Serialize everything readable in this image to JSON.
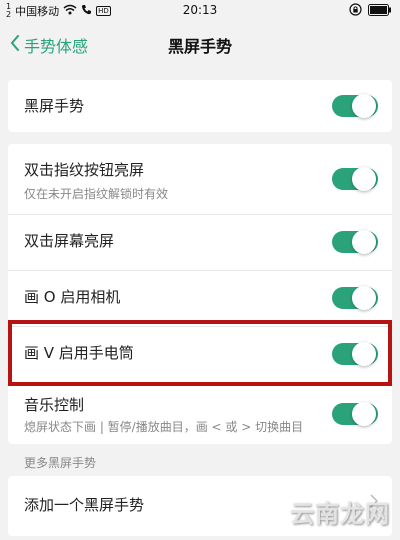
{
  "status_bar": {
    "signal_top": "1",
    "signal_bottom": "2",
    "carrier": "中国移动",
    "hd_badge": "HD",
    "time": "20:13",
    "icons": [
      "wifi-icon",
      "phone-icon",
      "rotation-lock-icon",
      "battery-icon"
    ]
  },
  "nav": {
    "back_label": "手势体感",
    "title": "黑屏手势"
  },
  "rows": [
    {
      "title": "黑屏手势",
      "subtitle": "",
      "toggle_on": true
    },
    {
      "title": "双击指纹按钮亮屏",
      "subtitle": "仅在未开启指纹解锁时有效",
      "toggle_on": true
    },
    {
      "title": "双击屏幕亮屏",
      "subtitle": "",
      "toggle_on": true
    },
    {
      "title": "画 O 启用相机",
      "subtitle": "",
      "toggle_on": true
    },
    {
      "title": "画 V 启用手电筒",
      "subtitle": "",
      "toggle_on": true
    },
    {
      "title": "音乐控制",
      "subtitle": "熄屏状态下画 | 暂停/播放曲目，画 < 或 > 切换曲目",
      "toggle_on": true
    }
  ],
  "section_label": "更多黑屏手势",
  "add_gesture_label": "添加一个黑屏手势",
  "watermark": "云南龙网",
  "colors": {
    "accent": "#2aa37a",
    "highlight": "#b71313",
    "background": "#f2f2f2"
  }
}
